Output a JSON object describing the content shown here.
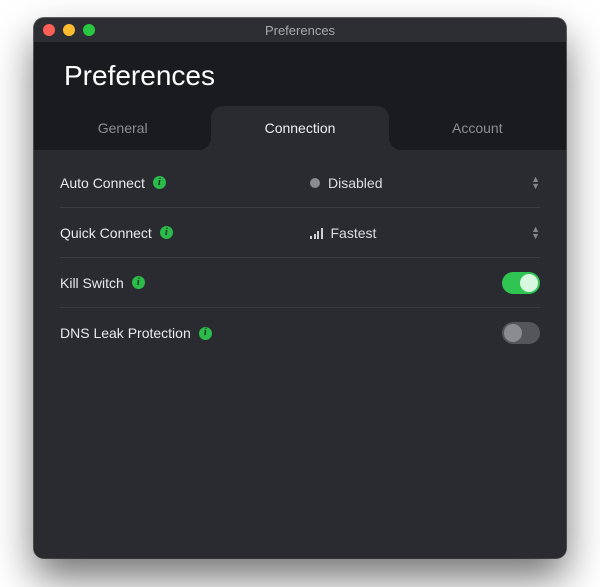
{
  "window": {
    "title": "Preferences"
  },
  "page": {
    "heading": "Preferences"
  },
  "tabs": {
    "general": "General",
    "connection": "Connection",
    "account": "Account",
    "active": "connection"
  },
  "rows": {
    "auto_connect": {
      "label": "Auto Connect",
      "value": "Disabled",
      "icon": "dot"
    },
    "quick_connect": {
      "label": "Quick Connect",
      "value": "Fastest",
      "icon": "signal-bars"
    },
    "kill_switch": {
      "label": "Kill Switch",
      "value": true
    },
    "dns_leak": {
      "label": "DNS Leak Protection",
      "value": false
    }
  },
  "colors": {
    "accent_green": "#30c552",
    "info_green": "#2bbb4a",
    "window_bg": "#1c1d22",
    "panel_bg": "#2a2b31"
  }
}
